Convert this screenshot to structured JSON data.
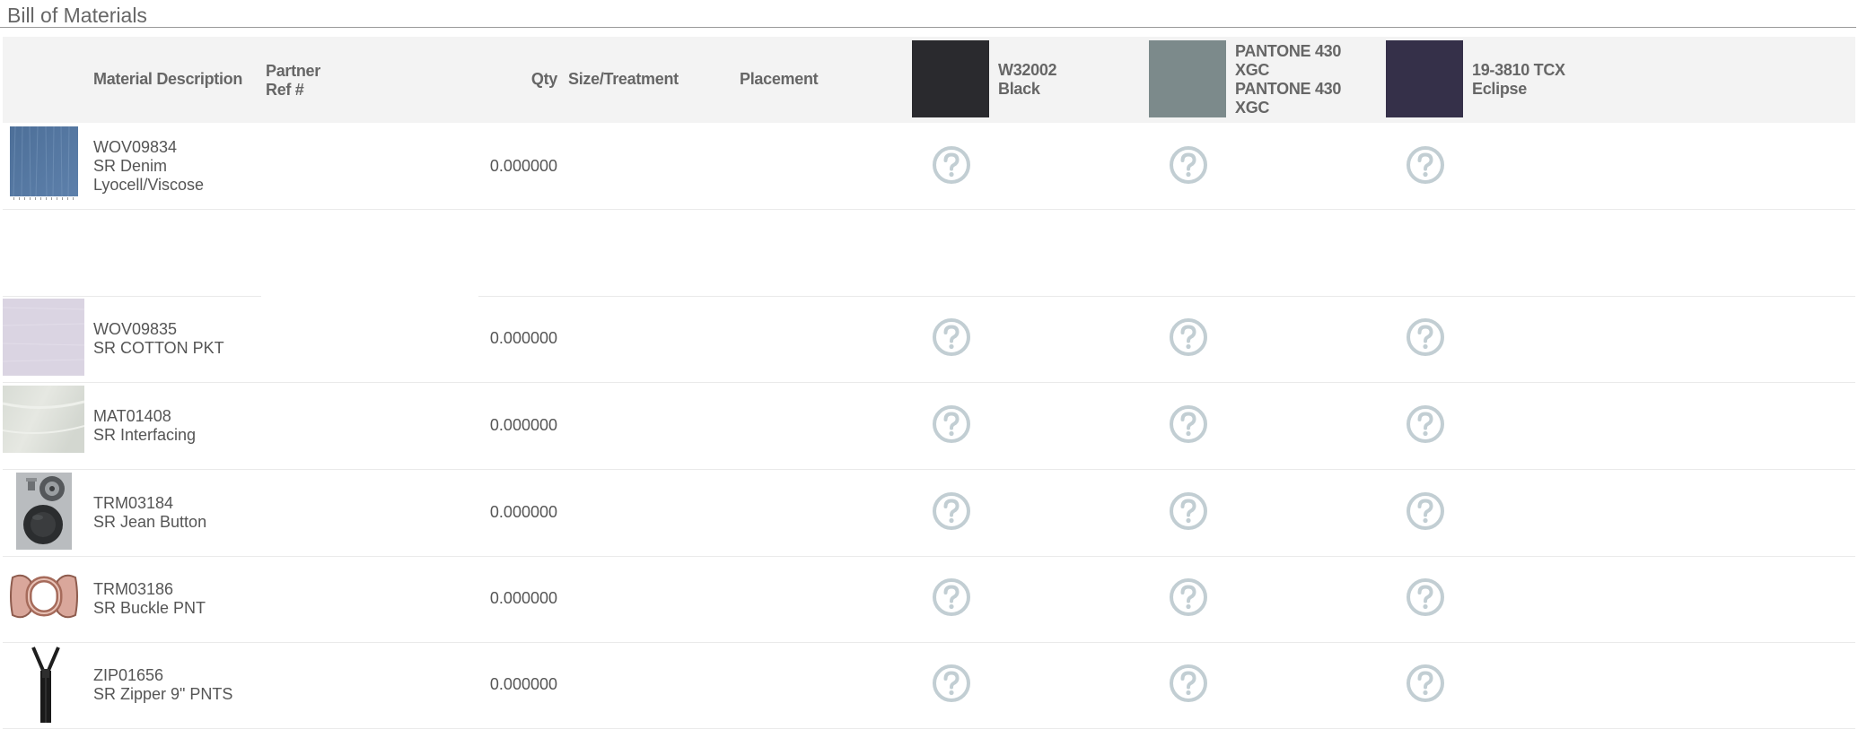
{
  "bom": {
    "title": "Bill of Materials",
    "headers": {
      "material_description": "Material Description",
      "partner_ref_line1": "Partner",
      "partner_ref_line2": "Ref #",
      "qty": "Qty",
      "size_treatment": "Size/Treatment",
      "placement": "Placement"
    },
    "colorways": [
      {
        "swatch_color": "#2a2a2e",
        "lines": [
          "W32002",
          "Black"
        ]
      },
      {
        "swatch_color": "#7c8a8b",
        "lines": [
          "PANTONE 430",
          "XGC",
          "PANTONE 430",
          "XGC"
        ]
      },
      {
        "swatch_color": "#353049",
        "lines": [
          "19-3810 TCX",
          "Eclipse"
        ]
      }
    ],
    "rows": [
      {
        "code": "WOV09834",
        "name": "SR Denim",
        "extra": "Lyocell/Viscose",
        "qty": "0.000000",
        "thumb": "denim-swatch"
      },
      {
        "code": "WOV09835",
        "name": "SR COTTON PKT",
        "extra": "",
        "qty": "0.000000",
        "thumb": "cotton-swatch"
      },
      {
        "code": "MAT01408",
        "name": "SR Interfacing",
        "extra": "",
        "qty": "0.000000",
        "thumb": "interfacing-swatch"
      },
      {
        "code": "TRM03184",
        "name": "SR Jean Button",
        "extra": "",
        "qty": "0.000000",
        "thumb": "jean-button-photo"
      },
      {
        "code": "TRM03186",
        "name": "SR Buckle PNT",
        "extra": "",
        "qty": "0.000000",
        "thumb": "buckle-photo"
      },
      {
        "code": "ZIP01656",
        "name": "SR Zipper 9\" PNTS",
        "extra": "",
        "qty": "0.000000",
        "thumb": "zipper-photo"
      }
    ],
    "unknown_status_icon": "question-circle-icon",
    "colors": {
      "header_bg": "#f3f3f3",
      "question_icon": "#c2ced3"
    }
  }
}
